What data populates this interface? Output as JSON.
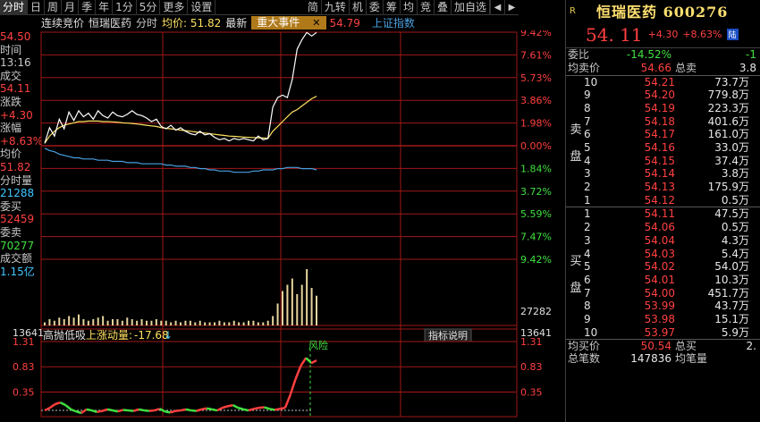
{
  "toolbar": {
    "items": [
      "分时",
      "日",
      "周",
      "月",
      "季",
      "年",
      "1分",
      "5分",
      "更多",
      "设置"
    ],
    "right_items": [
      "简",
      "九转",
      "机",
      "委",
      "筹",
      "均",
      "竞",
      "叠",
      "加自选"
    ],
    "prev": "◀",
    "next": "▶"
  },
  "chart_header": {
    "auction": "连续竞价",
    "stock": "恒瑞医药",
    "mode": "分时",
    "avg": "均价: 51.82",
    "latest": "最新",
    "event": "重大事件",
    "event_close": "✕",
    "price": "54.79",
    "index_label": "上证指数"
  },
  "left_panel": [
    {
      "t": "54.50",
      "c": "#ff4040"
    },
    {
      "t": "时间",
      "c": "#c8c8c8"
    },
    {
      "t": "13:16",
      "c": "#c8c8c8"
    },
    {
      "t": "成交",
      "c": "#c8c8c8"
    },
    {
      "t": "54.11",
      "c": "#ff4040"
    },
    {
      "t": "涨跌",
      "c": "#c8c8c8"
    },
    {
      "t": "+4.30",
      "c": "#ff4040"
    },
    {
      "t": "涨幅",
      "c": "#c8c8c8"
    },
    {
      "t": "+8.63%",
      "c": "#ff4040"
    },
    {
      "t": "均价",
      "c": "#c8c8c8"
    },
    {
      "t": "51.82",
      "c": "#ff4040"
    },
    {
      "t": "分时量",
      "c": "#c8c8c8"
    },
    {
      "t": "21288",
      "c": "#40c8ff"
    },
    {
      "t": "委买",
      "c": "#c8c8c8"
    },
    {
      "t": "52459",
      "c": "#ff4040"
    },
    {
      "t": "委卖",
      "c": "#c8c8c8"
    },
    {
      "t": "70277",
      "c": "#40e040"
    },
    {
      "t": "成交额",
      "c": "#c8c8c8"
    },
    {
      "t": "1.15亿",
      "c": "#40c8ff"
    }
  ],
  "chart_data": [
    {
      "type": "line",
      "y_right_up": [
        "9.42%",
        "7.61%",
        "5.73%",
        "3.86%",
        "1.98%",
        "0.00%"
      ],
      "y_right_down": [
        "1.84%",
        "3.72%",
        "5.59%",
        "7.47%",
        "9.42%"
      ],
      "price_series": [
        0.2,
        1.5,
        0.8,
        2.2,
        1.4,
        2.8,
        2.1,
        2.9,
        2.4,
        2.7,
        2.2,
        2.9,
        2.5,
        2.3,
        2.8,
        2.5,
        2.4,
        2.6,
        2.9,
        2.6,
        2.5,
        2.3,
        2.0,
        2.2,
        1.6,
        1.4,
        1.7,
        1.3,
        1.5,
        1.2,
        1.0,
        0.9,
        1.2,
        0.9,
        1.0,
        0.7,
        0.5,
        0.6,
        0.4,
        0.6,
        0.5,
        0.6,
        0.5,
        0.4,
        0.8,
        0.5,
        0.6,
        3.2,
        4.0,
        4.2,
        4.0,
        5.5,
        8.0,
        8.8,
        9.4,
        9.1,
        9.4
      ],
      "avg_series": [
        0.2,
        0.8,
        1.2,
        1.5,
        1.7,
        1.8,
        1.9,
        2.0,
        2.0,
        2.05,
        2.05,
        2.05,
        2.0,
        2.0,
        1.98,
        1.95,
        1.9,
        1.88,
        1.85,
        1.8,
        1.75,
        1.7,
        1.65,
        1.6,
        1.5,
        1.45,
        1.4,
        1.35,
        1.3,
        1.25,
        1.2,
        1.15,
        1.1,
        1.05,
        1.0,
        0.95,
        0.9,
        0.85,
        0.8,
        0.78,
        0.75,
        0.72,
        0.7,
        0.68,
        0.66,
        0.64,
        0.62,
        1.2,
        1.6,
        2.0,
        2.4,
        2.8,
        3.0,
        3.3,
        3.6,
        3.9,
        4.1
      ],
      "index_series": [
        -0.2,
        -0.4,
        -0.5,
        -0.7,
        -0.8,
        -0.9,
        -1.0,
        -1.0,
        -1.1,
        -1.1,
        -1.1,
        -1.2,
        -1.2,
        -1.2,
        -1.3,
        -1.3,
        -1.3,
        -1.4,
        -1.4,
        -1.4,
        -1.5,
        -1.5,
        -1.5,
        -1.5,
        -1.5,
        -1.6,
        -1.6,
        -1.7,
        -1.7,
        -1.7,
        -1.8,
        -1.8,
        -1.9,
        -1.9,
        -2.0,
        -2.0,
        -2.1,
        -2.1,
        -2.1,
        -2.2,
        -2.2,
        -2.2,
        -2.2,
        -2.1,
        -2.1,
        -2.0,
        -2.0,
        -2.0,
        -1.9,
        -1.9,
        -1.8,
        -1.8,
        -1.8,
        -1.9,
        -1.9,
        -1.9,
        -2.0
      ],
      "ylim_pct": [
        -9.42,
        9.42
      ]
    },
    {
      "type": "bar",
      "y_labels": [
        "27282",
        "13641"
      ],
      "left_label": "13641",
      "volumes": [
        2,
        4,
        3,
        5,
        4,
        6,
        5,
        7,
        4,
        3,
        4,
        5,
        6,
        3,
        4,
        4,
        3,
        5,
        4,
        3,
        4,
        3,
        3,
        4,
        3,
        3,
        2,
        3,
        2,
        3,
        3,
        2,
        3,
        2,
        2,
        2,
        3,
        2,
        2,
        3,
        2,
        2,
        3,
        3,
        2,
        2,
        3,
        6,
        14,
        22,
        26,
        30,
        20,
        26,
        36,
        24,
        19
      ],
      "ylim": [
        0,
        40000
      ]
    },
    {
      "type": "line",
      "title": "高抛低吸",
      "indicator_label": "上涨动量:",
      "indicator_value": "-17.68",
      "indicator_arrow": "↓",
      "help_label": "指标说明",
      "y_labels": [
        "1.31",
        "0.83",
        "0.35"
      ],
      "risk_label": "风险",
      "osc_series": [
        0.0,
        0.05,
        0.12,
        0.15,
        0.1,
        0.02,
        -0.02,
        -0.05,
        0.02,
        0.0,
        -0.03,
        -0.01,
        0.02,
        0.0,
        -0.02,
        0.01,
        0.0,
        -0.01,
        0.02,
        0.0,
        -0.01,
        0.0,
        0.03,
        -0.02,
        -0.04,
        -0.01,
        0.0,
        0.02,
        0.0,
        -0.01,
        0.02,
        0.04,
        0.02,
        0.0,
        0.05,
        0.08,
        0.1,
        0.05,
        0.02,
        0.0,
        0.03,
        0.05,
        0.06,
        0.03,
        0.01,
        0.03,
        0.05,
        0.3,
        0.6,
        0.85,
        1.0,
        0.9,
        0.95
      ],
      "ylim": [
        -0.05,
        1.31
      ]
    }
  ],
  "right_panel": {
    "badge": "R",
    "title": "恒瑞医药 600276",
    "price": "54. 11",
    "change": "+4.30",
    "change_pct": "+8.63%",
    "tag": "陆",
    "weibi_label": "委比",
    "weibi_value": "-14.52%",
    "weibi_extra": "-1",
    "avg_sell_label": "均卖价",
    "avg_sell_value": "54.66",
    "total_sell_label": "总卖",
    "total_sell_value": "3.8",
    "sell_side_label": [
      "卖",
      "盘"
    ],
    "buy_side_label": [
      "买",
      "盘"
    ],
    "sell_rows": [
      {
        "lv": "10",
        "p": "54.21",
        "v": "73.7万",
        "y": false
      },
      {
        "lv": "9",
        "p": "54.20",
        "v": "779.8万",
        "y": false
      },
      {
        "lv": "8",
        "p": "54.19",
        "v": "223.3万",
        "y": false
      },
      {
        "lv": "7",
        "p": "54.18",
        "v": "401.6万",
        "y": false
      },
      {
        "lv": "6",
        "p": "54.17",
        "v": "161.0万",
        "y": false
      },
      {
        "lv": "5",
        "p": "54.16",
        "v": "33.0万",
        "y": false
      },
      {
        "lv": "4",
        "p": "54.15",
        "v": "37.4万",
        "y": false
      },
      {
        "lv": "3",
        "p": "54.14",
        "v": "3.8万",
        "y": false
      },
      {
        "lv": "2",
        "p": "54.13",
        "v": "175.9万",
        "y": false
      },
      {
        "lv": "1",
        "p": "54.12",
        "v": "0.5万",
        "y": false
      }
    ],
    "buy_rows": [
      {
        "lv": "1",
        "p": "54.11",
        "v": "47.5万",
        "y": false
      },
      {
        "lv": "2",
        "p": "54.06",
        "v": "0.5万",
        "y": false
      },
      {
        "lv": "3",
        "p": "54.04",
        "v": "4.3万",
        "y": false
      },
      {
        "lv": "4",
        "p": "54.03",
        "v": "5.4万",
        "y": false
      },
      {
        "lv": "5",
        "p": "54.02",
        "v": "54.0万",
        "y": false
      },
      {
        "lv": "6",
        "p": "54.01",
        "v": "10.3万",
        "y": false
      },
      {
        "lv": "7",
        "p": "54.00",
        "v": "451.7万",
        "y": false
      },
      {
        "lv": "8",
        "p": "53.99",
        "v": "43.7万",
        "y": false
      },
      {
        "lv": "9",
        "p": "53.98",
        "v": "15.1万",
        "y": false
      },
      {
        "lv": "10",
        "p": "53.97",
        "v": "5.9万",
        "y": false
      }
    ],
    "avg_buy_label": "均买价",
    "avg_buy_value": "50.54",
    "total_buy_label": "总买",
    "total_buy_value": "2.",
    "trades_label": "总笔数",
    "trades_value": "147836",
    "avg_vol_label": "均笔量",
    "avg_vol_value": ""
  },
  "colors": {
    "up": "#ff4040",
    "down": "#40e040",
    "grid": "#a01818",
    "price_line": "#ffffff",
    "avg_line": "#ffe060",
    "index_line": "#4aa0e0",
    "volume": "#e6d49c",
    "axis_text": "#ff4040"
  }
}
